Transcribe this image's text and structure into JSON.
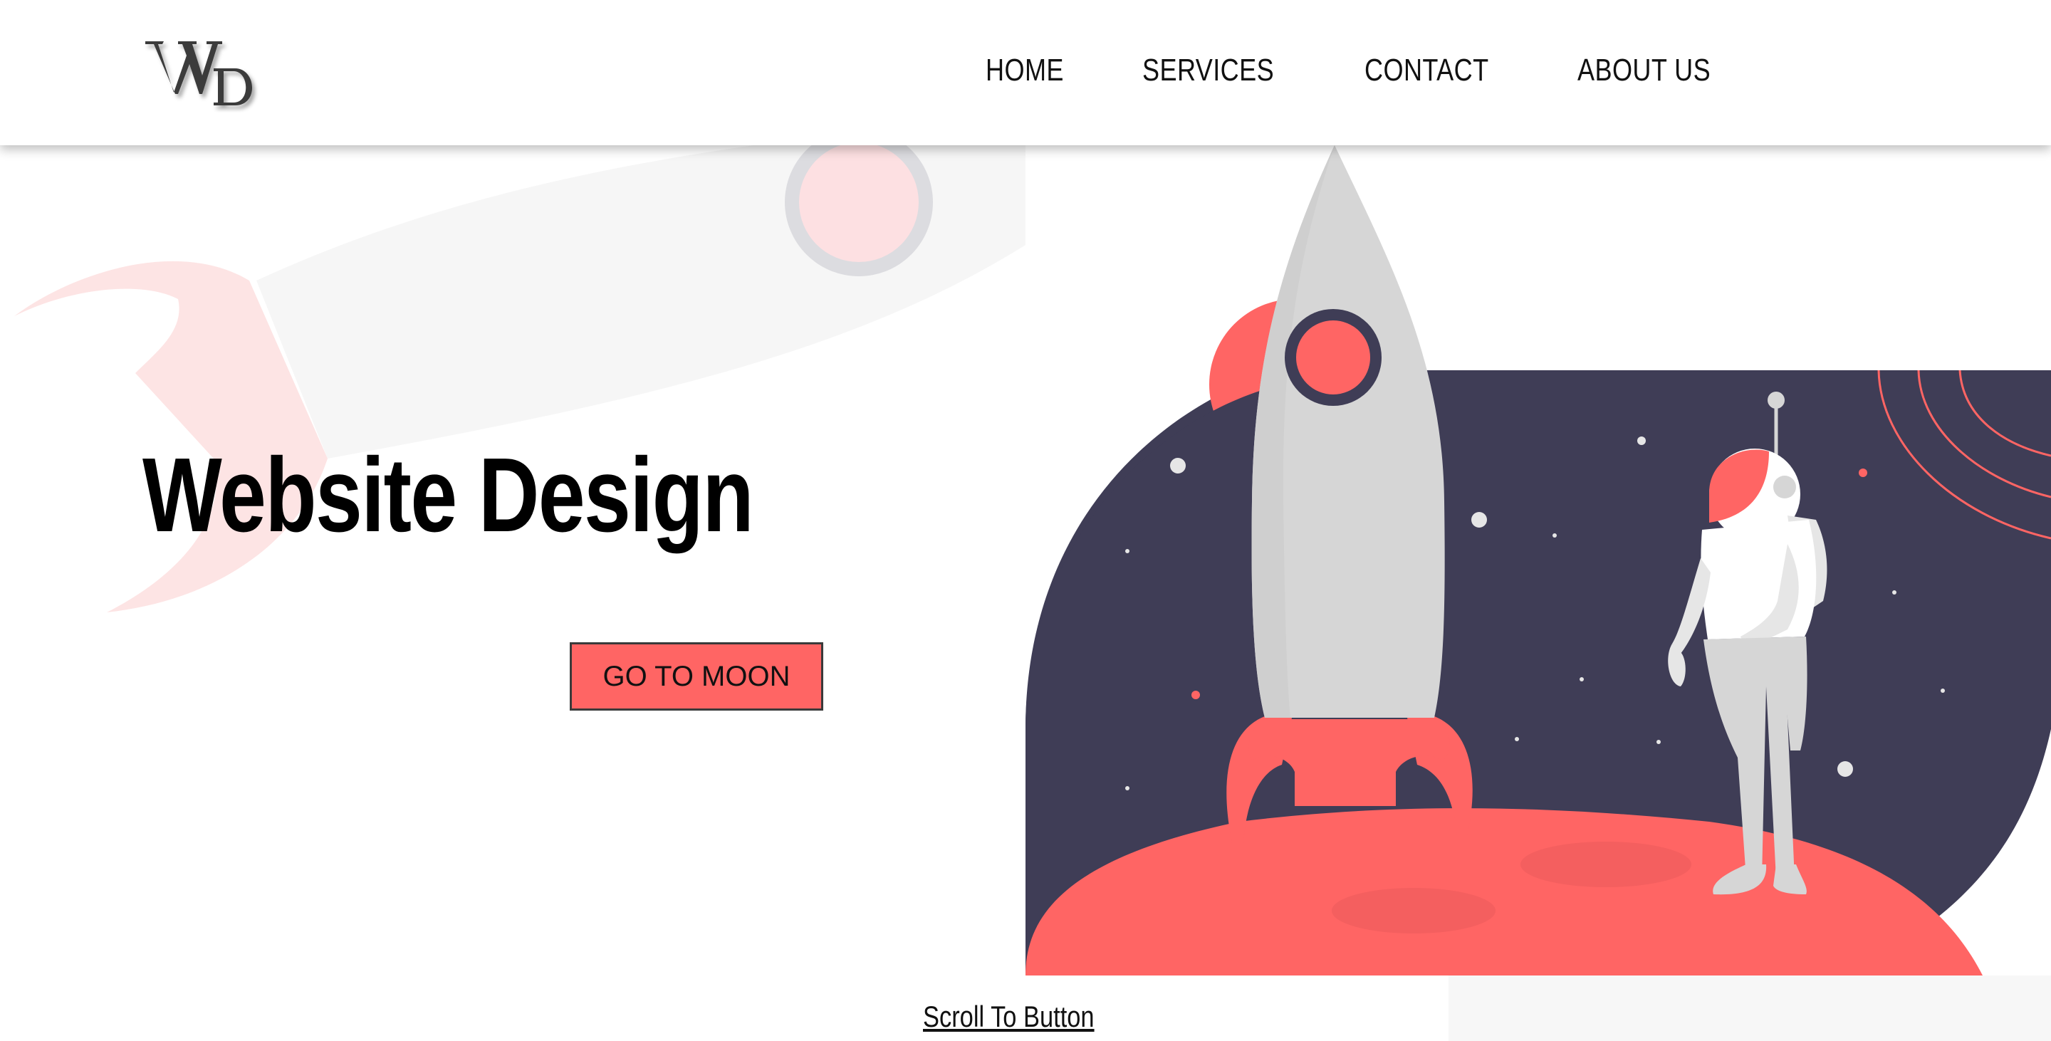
{
  "header": {
    "logo_text": "WD",
    "nav": [
      "HOME",
      "SERVICES",
      "CONTACT",
      "ABOUT US"
    ]
  },
  "hero": {
    "title": "Website Design",
    "button_label": "GO TO MOON"
  },
  "footer": {
    "scroll_link": "Scroll To Button"
  },
  "colors": {
    "accent": "#ff6564",
    "space": "#3f3d56",
    "rocket": "#d6d6d6",
    "background": "#ffffff"
  },
  "icons": [
    "logo-icon",
    "rocket-illustration",
    "astronaut-illustration"
  ]
}
